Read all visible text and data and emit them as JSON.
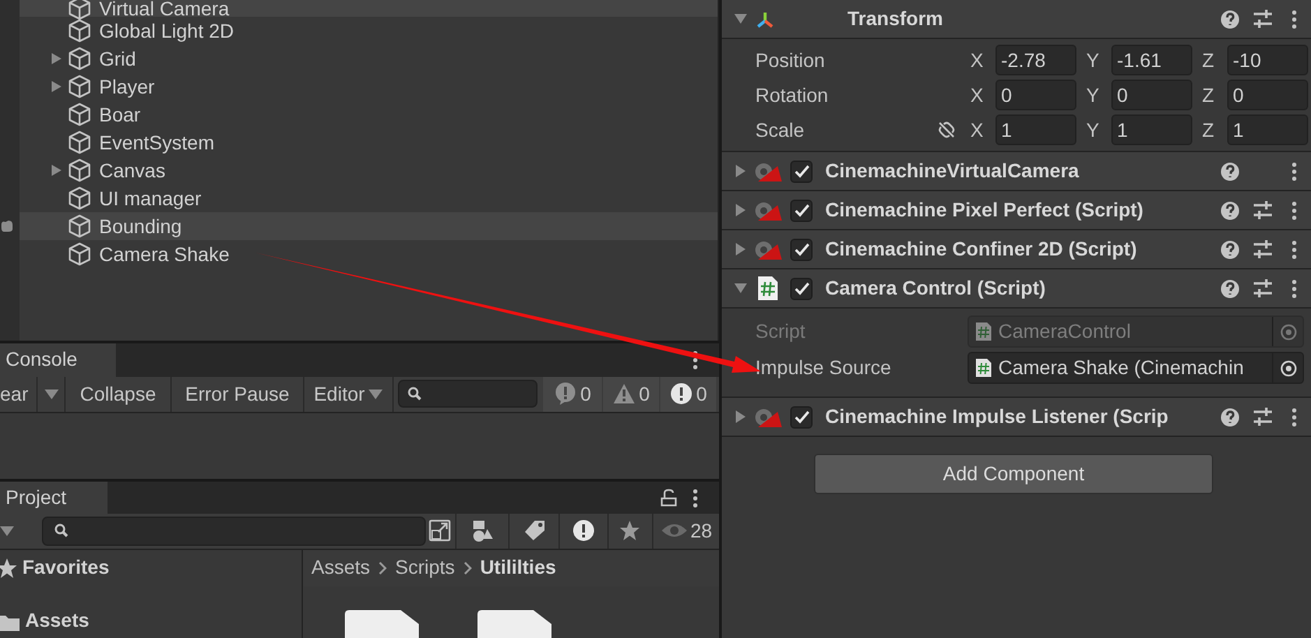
{
  "hierarchy": {
    "items": [
      {
        "name": "Virtual Camera",
        "expandable": false,
        "highlighted": true,
        "gutter_marker": false
      },
      {
        "name": "Global Light 2D",
        "expandable": false,
        "highlighted": false,
        "gutter_marker": false
      },
      {
        "name": "Grid",
        "expandable": true,
        "highlighted": false,
        "gutter_marker": false
      },
      {
        "name": "Player",
        "expandable": true,
        "highlighted": false,
        "gutter_marker": false
      },
      {
        "name": "Boar",
        "expandable": false,
        "highlighted": false,
        "gutter_marker": false
      },
      {
        "name": "EventSystem",
        "expandable": false,
        "highlighted": false,
        "gutter_marker": false
      },
      {
        "name": "Canvas",
        "expandable": true,
        "highlighted": false,
        "gutter_marker": false
      },
      {
        "name": "UI manager",
        "expandable": false,
        "highlighted": false,
        "gutter_marker": false
      },
      {
        "name": "Bounding",
        "expandable": false,
        "highlighted": true,
        "gutter_marker": true
      },
      {
        "name": "Camera Shake",
        "expandable": false,
        "highlighted": false,
        "gutter_marker": false
      }
    ]
  },
  "console": {
    "tab": "Console",
    "buttons": [
      {
        "label": "ear",
        "kind": "button"
      },
      {
        "kind": "arrow"
      },
      {
        "label": "Collapse",
        "kind": "button"
      },
      {
        "label": "Error Pause",
        "kind": "button"
      },
      {
        "label": "Editor",
        "kind": "dropdown"
      }
    ],
    "counts": [
      {
        "kind": "info",
        "count": "0"
      },
      {
        "kind": "warning",
        "count": "0"
      },
      {
        "kind": "error",
        "count": "0"
      }
    ]
  },
  "project": {
    "tab": "Project",
    "visible_count": "28",
    "favorites": "Favorites",
    "assets": "Assets",
    "breadcrumb": [
      "Assets",
      "Scripts",
      "Utililties"
    ]
  },
  "inspector": {
    "transform": {
      "title": "Transform",
      "expanded": true,
      "rows": [
        {
          "label": "Position",
          "constrained": false,
          "fields": [
            {
              "axis": "X",
              "value": "-2.78"
            },
            {
              "axis": "Y",
              "value": "-1.61"
            },
            {
              "axis": "Z",
              "value": "-10"
            }
          ]
        },
        {
          "label": "Rotation",
          "constrained": false,
          "fields": [
            {
              "axis": "X",
              "value": "0"
            },
            {
              "axis": "Y",
              "value": "0"
            },
            {
              "axis": "Z",
              "value": "0"
            }
          ]
        },
        {
          "label": "Scale",
          "constrained": true,
          "fields": [
            {
              "axis": "X",
              "value": "1"
            },
            {
              "axis": "Y",
              "value": "1"
            },
            {
              "axis": "Z",
              "value": "1"
            }
          ]
        }
      ]
    },
    "components": [
      {
        "title": "CinemachineVirtualCamera",
        "kind": "cinemachine",
        "enabled": true,
        "expanded": false,
        "presets": false
      },
      {
        "title": "Cinemachine Pixel Perfect (Script)",
        "kind": "cinemachine",
        "enabled": true,
        "expanded": false,
        "presets": true
      },
      {
        "title": "Cinemachine Confiner 2D (Script)",
        "kind": "cinemachine",
        "enabled": true,
        "expanded": false,
        "presets": true
      },
      {
        "title": "Camera Control (Script)",
        "kind": "script",
        "enabled": true,
        "expanded": true,
        "presets": true,
        "fields": [
          {
            "label": "Script",
            "value": "CameraControl",
            "disabled": true
          },
          {
            "label": "Impulse Source",
            "value": "Camera Shake (Cinemachin",
            "disabled": false
          }
        ]
      },
      {
        "title": "Cinemachine Impulse Listener (Scrip",
        "kind": "cinemachine",
        "enabled": true,
        "expanded": false,
        "presets": true
      }
    ],
    "add_button": "Add Component"
  }
}
